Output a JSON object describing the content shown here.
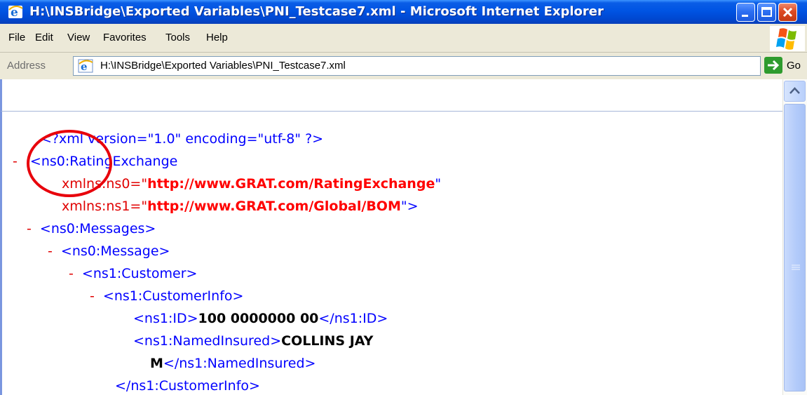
{
  "window": {
    "title": "H:\\INSBridge\\Exported Variables\\PNI_Testcase7.xml - Microsoft Internet Explorer"
  },
  "menu": {
    "file": "File",
    "edit": "Edit",
    "view": "View",
    "favorites": "Favorites",
    "tools": "Tools",
    "help": "Help"
  },
  "address": {
    "label": "Address",
    "value": "H:\\INSBridge\\Exported Variables\\PNI_Testcase7.xml",
    "go_label": "Go"
  },
  "xml": {
    "decl": "<?xml version=\"1.0\" encoding=\"utf-8\" ?>",
    "collapse_marker": "-",
    "root_open": "<ns0:RatingExchange",
    "ns0_attr": "xmlns:ns0=\"",
    "ns0_value": "http://www.GRAT.com/RatingExchange",
    "ns0_close": "\"",
    "ns1_attr": "xmlns:ns1=\"",
    "ns1_value": "http://www.GRAT.com/Global/BOM",
    "ns1_close": "\">",
    "messages_open": "<ns0:Messages>",
    "message_open": "<ns0:Message>",
    "customer_open": "<ns1:Customer>",
    "customerinfo_open": "<ns1:CustomerInfo>",
    "id_open": "<ns1:ID>",
    "id_value": "100 0000000 00",
    "id_close": "</ns1:ID>",
    "named_open": "<ns1:NamedInsured>",
    "named_value_1": "COLLINS JAY",
    "named_value_2": "M",
    "named_close": "</ns1:NamedInsured>",
    "customerinfo_close": "</ns1:CustomerInfo>"
  },
  "colors": {
    "xml_tag": "#0000ff",
    "xml_element": "#990000",
    "collapse_marker": "#e00000",
    "attr_value": "#ff0000",
    "annotation": "#e8000b"
  },
  "icons": {
    "title": "ie-icon",
    "address": "page-icon",
    "go": "go-arrow-icon",
    "brand": "windows-logo"
  }
}
